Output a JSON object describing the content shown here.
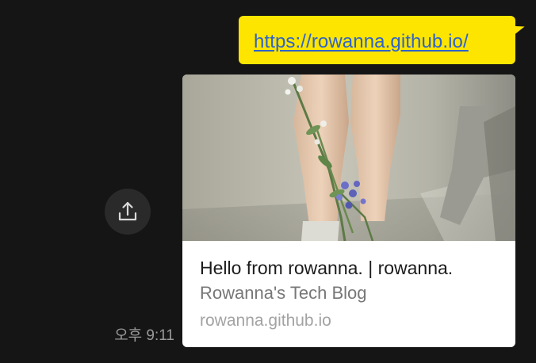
{
  "message": {
    "link_text": "https://rowanna.github.io/",
    "bubble_color": "#FEE500",
    "link_color": "#2E63C8"
  },
  "preview": {
    "title": "Hello from rowanna. | rowanna.",
    "subtitle": "Rowanna's Tech Blog",
    "domain": "rowanna.github.io",
    "image_description_icon": "legs-with-flowers-photo"
  },
  "share": {
    "icon": "share-upload-icon"
  },
  "meta": {
    "timestamp": "오후 9:11"
  },
  "colors": {
    "background": "#151515",
    "card": "#ffffff",
    "share_button": "#2a2a2a"
  }
}
